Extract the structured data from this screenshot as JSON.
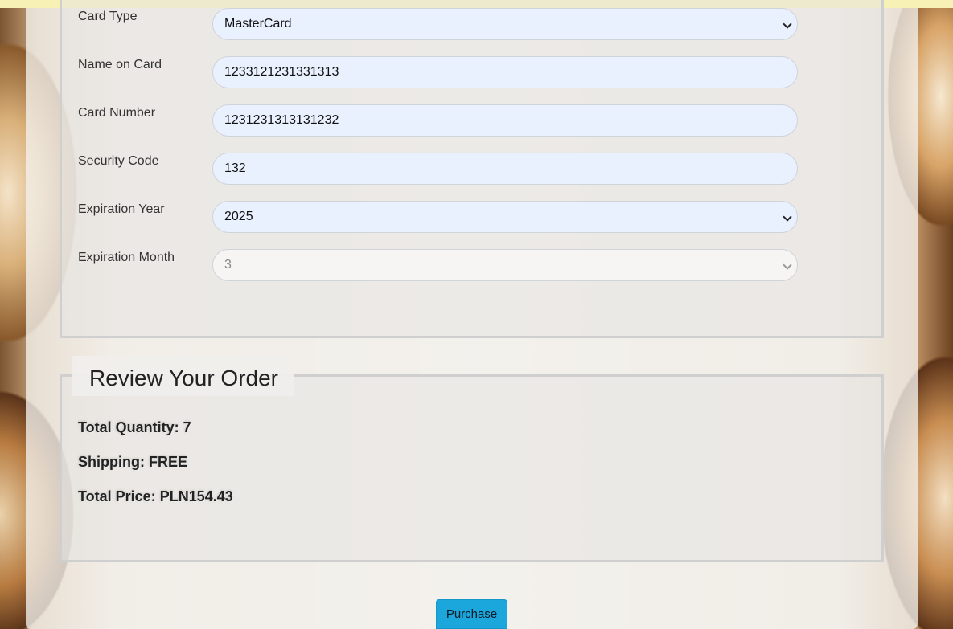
{
  "payment": {
    "fields": [
      {
        "label": "Card Type",
        "value": "MasterCard",
        "type": "select"
      },
      {
        "label": "Name on Card",
        "value": "1233121231331313",
        "type": "text"
      },
      {
        "label": "Card Number",
        "value": "1231231313131232",
        "type": "text"
      },
      {
        "label": "Security Code",
        "value": "132",
        "type": "text"
      },
      {
        "label": "Expiration Year",
        "value": "2025",
        "type": "select"
      },
      {
        "label": "Expiration Month",
        "value": "3",
        "type": "select",
        "disabled": true
      }
    ]
  },
  "review": {
    "title": "Review Your Order",
    "total_quantity": "Total Quantity: 7",
    "shipping": "Shipping: FREE",
    "total_price": "Total Price: PLN154.43"
  },
  "actions": {
    "purchase_label": "Purchase"
  },
  "colors": {
    "accent": "#1ba6dc",
    "input_bg": "#e9f0fe",
    "top_banner": "#f7f1b5"
  }
}
